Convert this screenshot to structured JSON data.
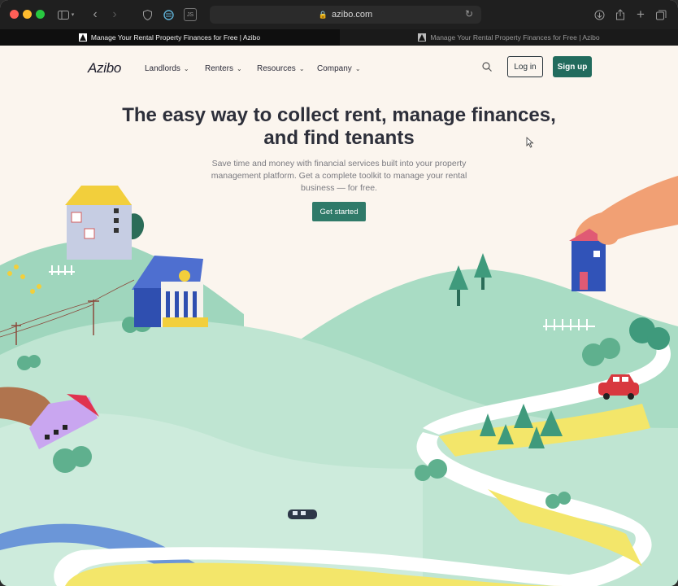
{
  "browser": {
    "url": "azibo.com",
    "tabs": [
      {
        "title": "Manage Your Rental Property Finances for Free | Azibo",
        "active": true
      },
      {
        "title": "Manage Your Rental Property Finances for Free | Azibo",
        "active": false
      }
    ],
    "extension_badge": "JS"
  },
  "nav": {
    "logo": "Azibo",
    "menu": [
      {
        "label": "Landlords"
      },
      {
        "label": "Renters"
      },
      {
        "label": "Resources"
      },
      {
        "label": "Company"
      }
    ],
    "login_label": "Log in",
    "signup_label": "Sign up"
  },
  "hero": {
    "headline": "The easy way to collect rent, manage finances, and find tenants",
    "subtext": "Save time and money with financial services built into your property management platform. Get a complete toolkit to manage your rental business — for free.",
    "cta_label": "Get started"
  },
  "colors": {
    "brand_green": "#216b5d",
    "page_bg": "#fbf5ee",
    "hill_green": "#9fd6bd",
    "road_yellow": "#f3e66a"
  }
}
